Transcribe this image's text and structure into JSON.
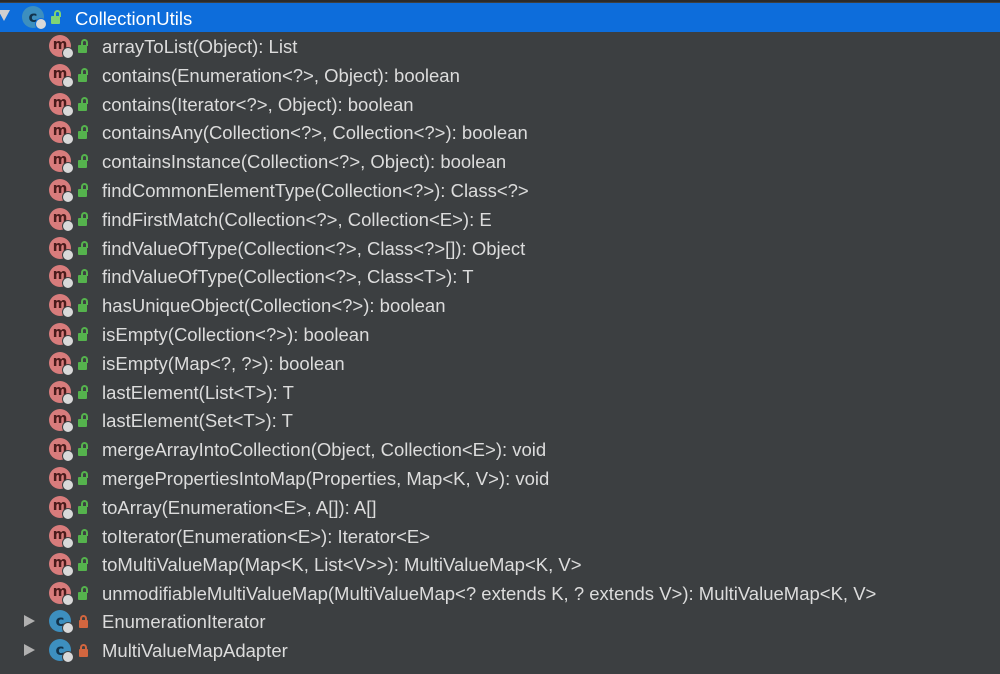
{
  "tree": {
    "root": {
      "label": "CollectionUtils",
      "icon": "class-icon",
      "expanded": true,
      "selected": true,
      "colors": {
        "selection": "#0d6ddb",
        "background": "#3c3f41",
        "text": "#dcdcdc"
      }
    },
    "methods": [
      {
        "label": "arrayToList(Object): List"
      },
      {
        "label": "contains(Enumeration<?>, Object): boolean"
      },
      {
        "label": "contains(Iterator<?>, Object): boolean"
      },
      {
        "label": "containsAny(Collection<?>, Collection<?>): boolean"
      },
      {
        "label": "containsInstance(Collection<?>, Object): boolean"
      },
      {
        "label": "findCommonElementType(Collection<?>): Class<?>"
      },
      {
        "label": "findFirstMatch(Collection<?>, Collection<E>): E"
      },
      {
        "label": "findValueOfType(Collection<?>, Class<?>[]): Object"
      },
      {
        "label": "findValueOfType(Collection<?>, Class<T>): T"
      },
      {
        "label": "hasUniqueObject(Collection<?>): boolean"
      },
      {
        "label": "isEmpty(Collection<?>): boolean"
      },
      {
        "label": "isEmpty(Map<?, ?>): boolean"
      },
      {
        "label": "lastElement(List<T>): T"
      },
      {
        "label": "lastElement(Set<T>): T"
      },
      {
        "label": "mergeArrayIntoCollection(Object, Collection<E>): void"
      },
      {
        "label": "mergePropertiesIntoMap(Properties, Map<K, V>): void"
      },
      {
        "label": "toArray(Enumeration<E>, A[]): A[]"
      },
      {
        "label": "toIterator(Enumeration<E>): Iterator<E>"
      },
      {
        "label": "toMultiValueMap(Map<K, List<V>>): MultiValueMap<K, V>"
      },
      {
        "label": "unmodifiableMultiValueMap(MultiValueMap<? extends K, ? extends V>): MultiValueMap<K, V>"
      }
    ],
    "inner_classes": [
      {
        "label": "EnumerationIterator",
        "expanded": false
      },
      {
        "label": "MultiValueMapAdapter",
        "expanded": false
      }
    ]
  }
}
